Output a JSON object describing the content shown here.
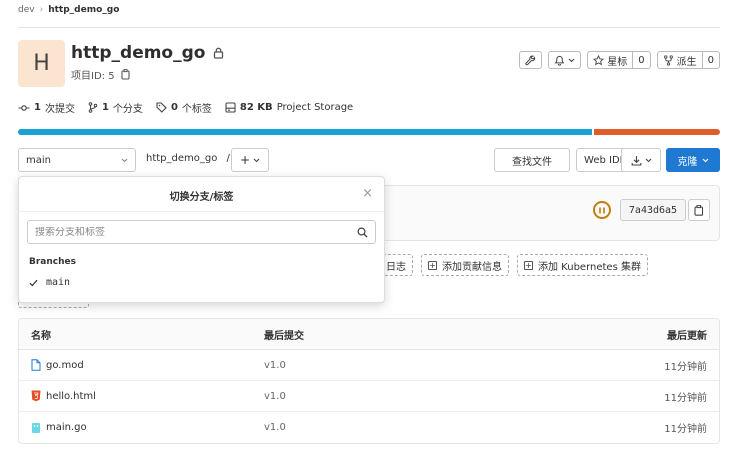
{
  "breadcrumb": {
    "group": "dev",
    "project": "http_demo_go"
  },
  "project": {
    "avatar_letter": "H",
    "name": "http_demo_go",
    "id_label": "项目ID: 5"
  },
  "actions": {
    "star_label": "星标",
    "star_count": "0",
    "fork_label": "派生",
    "fork_count": "0"
  },
  "stats": {
    "commits": {
      "value": "1",
      "label": "次提交"
    },
    "branches": {
      "value": "1",
      "label": "个分支"
    },
    "tags": {
      "value": "0",
      "label": "个标签"
    },
    "storage": {
      "value": "82 KB",
      "label": "Project Storage"
    }
  },
  "languages": [
    {
      "share": 0.818,
      "color": "#17a2d2"
    },
    {
      "share": 0.182,
      "color": "#e05d2b"
    }
  ],
  "toolbar": {
    "branch": "main",
    "path": "http_demo_go",
    "path_sep": "/",
    "find_file": "查找文件",
    "web_ide": "Web IDE",
    "clone": "克隆"
  },
  "commit": {
    "sha": "7a43d6a5"
  },
  "quick_actions": [
    {
      "label": "日志"
    },
    {
      "label": "添加贡献信息"
    },
    {
      "label": "添加 Kubernetes 集群"
    }
  ],
  "dropdown": {
    "title": "切换分支/标签",
    "search_placeholder": "搜索分支和标签",
    "section": "Branches",
    "items": [
      {
        "label": "main",
        "selected": true
      }
    ]
  },
  "file_table": {
    "headers": {
      "name": "名称",
      "last_commit": "最后提交",
      "last_update": "最后更新"
    },
    "rows": [
      {
        "name": "go.mod",
        "commit": "v1.0",
        "updated": "11分钟前",
        "icon": "file-icon"
      },
      {
        "name": "hello.html",
        "commit": "v1.0",
        "updated": "11分钟前",
        "icon": "html5-icon"
      },
      {
        "name": "main.go",
        "commit": "v1.0",
        "updated": "11分钟前",
        "icon": "go-file-icon"
      }
    ]
  }
}
